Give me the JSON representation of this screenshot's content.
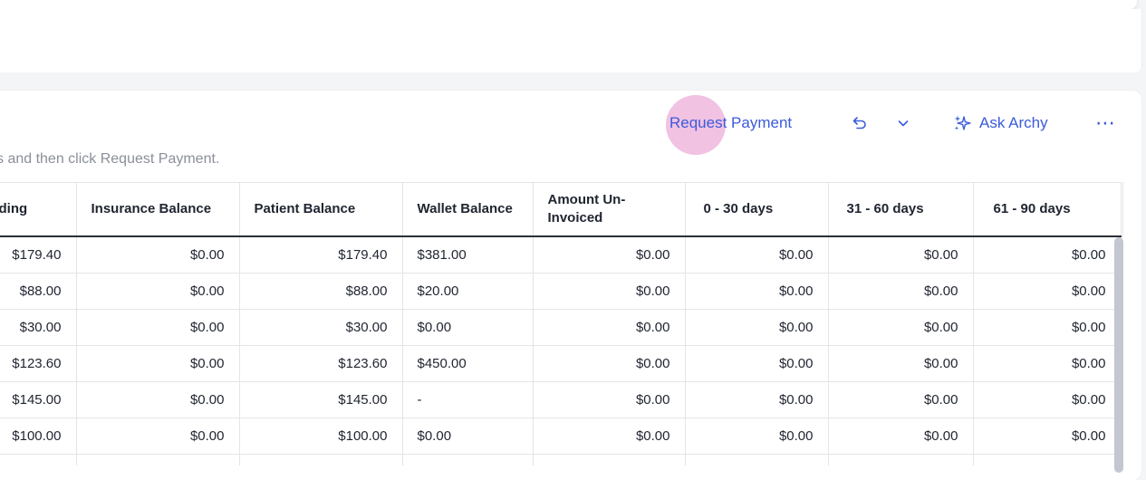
{
  "toolbar": {
    "request_payment": "Request Payment",
    "ask_archy": "Ask Archy",
    "more": "⋯"
  },
  "hint": "s and then click Request Payment.",
  "table": {
    "headers": [
      "tanding",
      "Insurance Balance",
      "Patient Balance",
      "Wallet Balance",
      "Amount Un-Invoiced",
      "0 - 30 days",
      "31 - 60 days",
      "61 - 90 days"
    ],
    "rows": [
      [
        "$179.40",
        "$0.00",
        "$179.40",
        "$381.00",
        "$0.00",
        "$0.00",
        "$0.00",
        "$0.00"
      ],
      [
        "$88.00",
        "$0.00",
        "$88.00",
        "$20.00",
        "$0.00",
        "$0.00",
        "$0.00",
        "$0.00"
      ],
      [
        "$30.00",
        "$0.00",
        "$30.00",
        "$0.00",
        "$0.00",
        "$0.00",
        "$0.00",
        "$0.00"
      ],
      [
        "$123.60",
        "$0.00",
        "$123.60",
        "$450.00",
        "$0.00",
        "$0.00",
        "$0.00",
        "$0.00"
      ],
      [
        "$145.00",
        "$0.00",
        "$145.00",
        "-",
        "$0.00",
        "$0.00",
        "$0.00",
        "$0.00"
      ],
      [
        "$100.00",
        "$0.00",
        "$100.00",
        "$0.00",
        "$0.00",
        "$0.00",
        "$0.00",
        "$0.00"
      ],
      [
        "",
        "",
        "",
        "",
        "",
        "",
        "",
        ""
      ]
    ]
  },
  "colors": {
    "accent": "#3b5bdb",
    "click_marker": "#e178be"
  }
}
